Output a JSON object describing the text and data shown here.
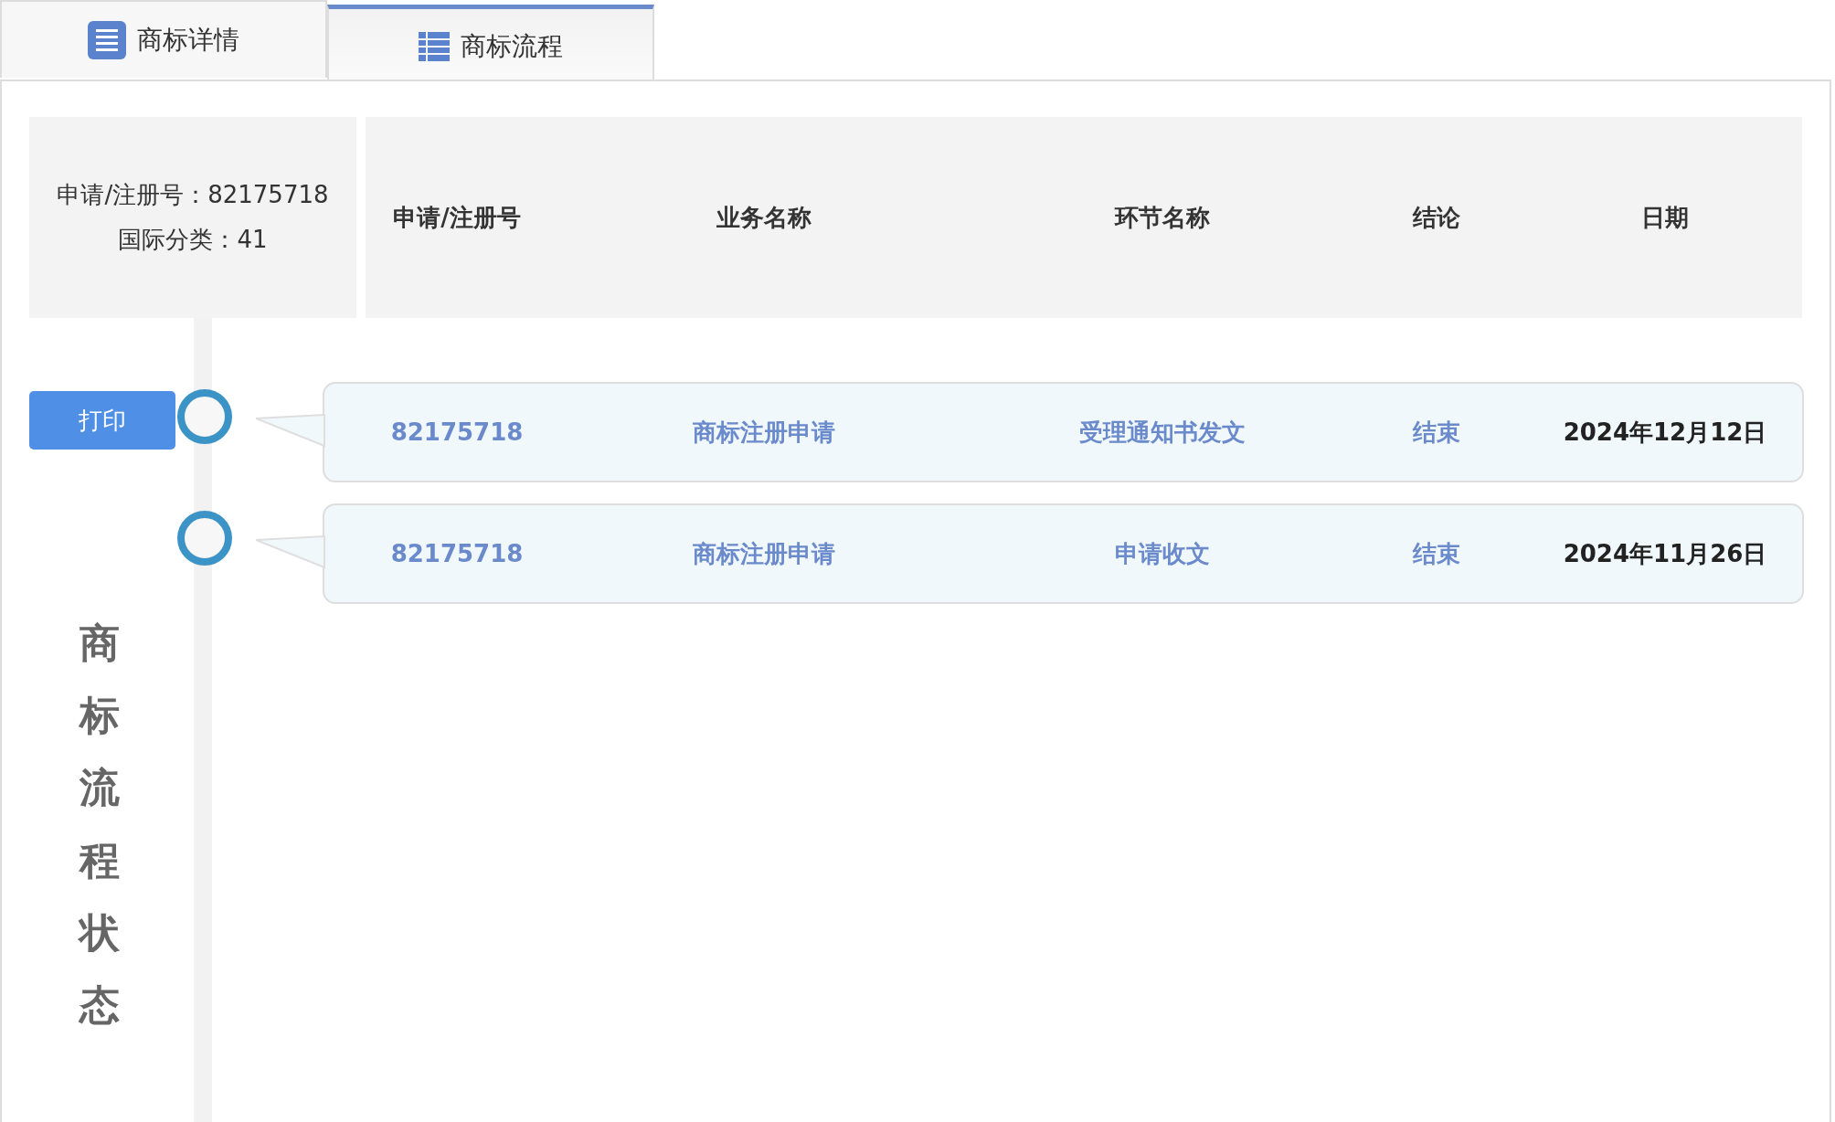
{
  "tabs": [
    {
      "label": "商标详情",
      "selected": false,
      "kind": "details"
    },
    {
      "label": "商标流程",
      "selected": true,
      "kind": "flow"
    }
  ],
  "summary": {
    "registration_number": "申请/注册号：82175718",
    "international_class": "国际分类：41"
  },
  "columns": [
    "申请/注册号",
    "业务名称",
    "环节名称",
    "结论",
    "日期"
  ],
  "print_button": "打印",
  "records": [
    {
      "number": "82175718",
      "business": "商标注册申请",
      "step": "受理通知书发文",
      "conclusion": "结束",
      "date": "2024年12月12日"
    },
    {
      "number": "82175718",
      "business": "商标注册申请",
      "step": "申请收文",
      "conclusion": "结束",
      "date": "2024年11月26日"
    }
  ],
  "side_title": "商标流程状态"
}
